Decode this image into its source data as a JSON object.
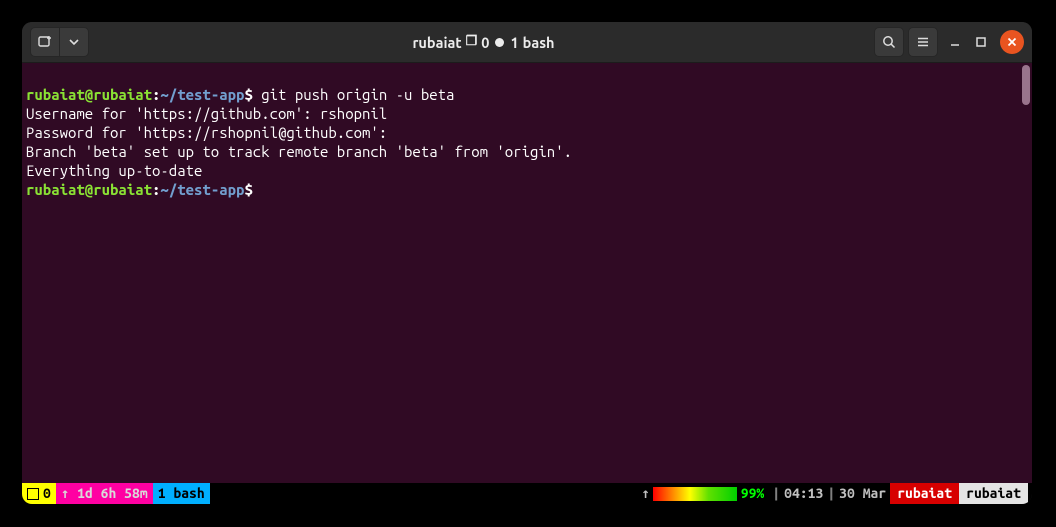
{
  "titlebar": {
    "app_user": "rubaiat",
    "squares": "0",
    "dots": "1",
    "process": "bash"
  },
  "terminal": {
    "prompt": {
      "userhost": "rubaiat@rubaiat",
      "sep": ":",
      "path": "~/test-app",
      "sigil": "$"
    },
    "cmd1": " git push origin -u beta",
    "out1": "Username for 'https://github.com': rshopnil",
    "out2": "Password for 'https://rshopnil@github.com':",
    "out3": "Branch 'beta' set up to track remote branch 'beta' from 'origin'.",
    "out4": "Everything up-to-date"
  },
  "statusbar": {
    "session": "0",
    "uptime": "↑ 1d 6h 58m",
    "window": " 1 bash ",
    "net": "↑",
    "battery": "99%",
    "time": "04:13",
    "date": "30 Mar",
    "host": "rubaiat",
    "user": "rubaiat",
    "sep": "|"
  }
}
